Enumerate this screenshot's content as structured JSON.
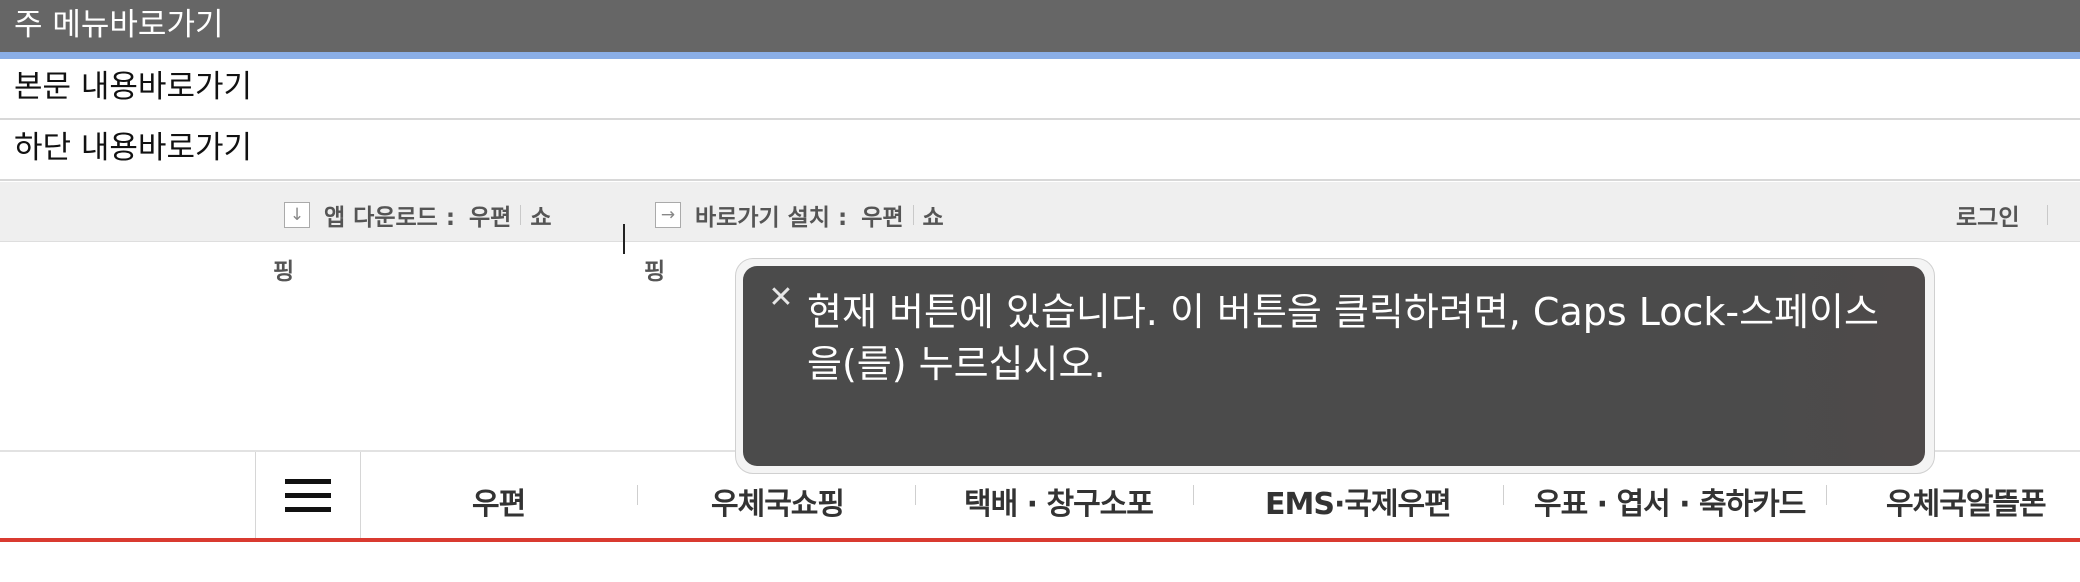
{
  "skip_links": {
    "main_menu": "주 메뉴바로가기",
    "content": "본문 내용바로가기",
    "footer": "하단 내용바로가기"
  },
  "utility": {
    "app_download": {
      "icon": "down-arrow-icon",
      "label": "앱 다운로드 :",
      "links": [
        "우편",
        "쇼"
      ]
    },
    "shortcut_install": {
      "icon": "right-arrow-icon",
      "label": "바로가기 설치 :",
      "links": [
        "우편",
        "쇼"
      ]
    },
    "login": "로그인"
  },
  "ping_labels": [
    "핑",
    "핑"
  ],
  "gnb": {
    "menu_icon": "hamburger-menu-icon",
    "items": [
      "우편",
      "우체국쇼핑",
      "택배 · 창구소포",
      "EMS·국제우편",
      "우표 · 엽서 · 축하카드",
      "우체국알뜰폰"
    ]
  },
  "tooltip": {
    "close_icon": "close-icon",
    "text": "현재 버튼에 있습니다. 이 버튼을 클릭하려면, Caps Lock-스페이스을(를) 누르십시오."
  },
  "colors": {
    "skip_bar_bg": "#666666",
    "skip_bar_border": "#8aaee6",
    "gnb_underline": "#d93a30",
    "tooltip_bg": "#4b4b4b"
  }
}
